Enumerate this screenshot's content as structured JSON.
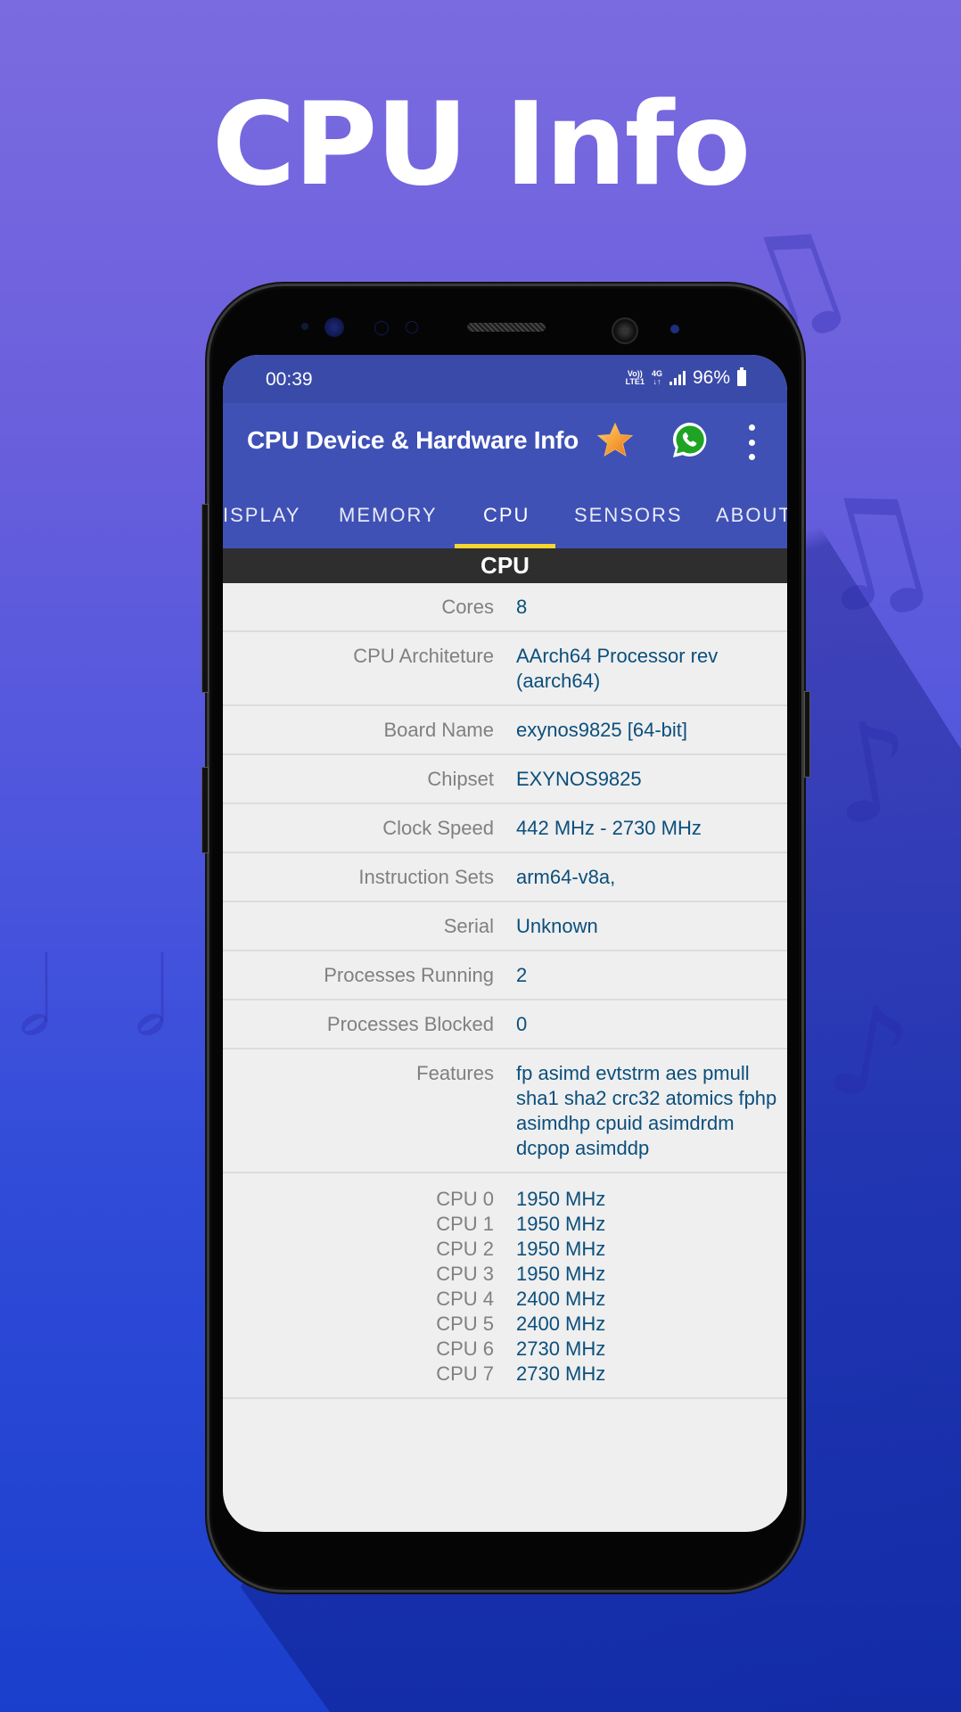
{
  "headline": "CPU Info",
  "status_bar": {
    "time": "00:39",
    "volte_label_top": "Vo))",
    "volte_label_bottom": "LTE1",
    "network_top": "4G",
    "network_bottom": "↓↑",
    "battery_percent": "96%"
  },
  "app_bar": {
    "title": "CPU Device & Hardware Info",
    "icons": [
      "star-icon",
      "whatsapp-icon",
      "more-vert-icon"
    ]
  },
  "tabs": [
    {
      "label": "ISPLAY",
      "active": false
    },
    {
      "label": "MEMORY",
      "active": false
    },
    {
      "label": "CPU",
      "active": true
    },
    {
      "label": "SENSORS",
      "active": false
    },
    {
      "label": "ABOUT",
      "active": false
    }
  ],
  "section_title": "CPU",
  "rows": [
    {
      "label": "Cores",
      "value": "8"
    },
    {
      "label": "CPU Architeture",
      "value": "AArch64 Processor rev (aarch64)"
    },
    {
      "label": "Board Name",
      "value": "exynos9825 [64-bit]"
    },
    {
      "label": "Chipset",
      "value": "EXYNOS9825"
    },
    {
      "label": "Clock Speed",
      "value": "442 MHz - 2730 MHz"
    },
    {
      "label": "Instruction Sets",
      "value": "arm64-v8a,"
    },
    {
      "label": "Serial",
      "value": "Unknown"
    },
    {
      "label": "Processes Running",
      "value": "2"
    },
    {
      "label": "Processes Blocked",
      "value": "0"
    },
    {
      "label": "Features",
      "value": "fp asimd evtstrm aes pmull sha1 sha2 crc32 atomics fphp asimdhp cpuid asimdrdm dcpop asimddp"
    }
  ],
  "cpu_cores": [
    {
      "label": "CPU 0",
      "value": "1950 MHz"
    },
    {
      "label": "CPU 1",
      "value": "1950 MHz"
    },
    {
      "label": "CPU 2",
      "value": "1950 MHz"
    },
    {
      "label": "CPU 3",
      "value": "1950 MHz"
    },
    {
      "label": "CPU 4",
      "value": "2400 MHz"
    },
    {
      "label": "CPU 5",
      "value": "2400 MHz"
    },
    {
      "label": "CPU 6",
      "value": "2730 MHz"
    },
    {
      "label": "CPU 7",
      "value": "2730 MHz"
    }
  ],
  "colors": {
    "app_bar": "#3f51b5",
    "status_bar": "#3a4aa8",
    "tab_indicator": "#f5d630",
    "section_header": "#2e2e2e",
    "label_text": "#808080",
    "value_text": "#0b4f7c",
    "list_bg": "#efefef"
  }
}
